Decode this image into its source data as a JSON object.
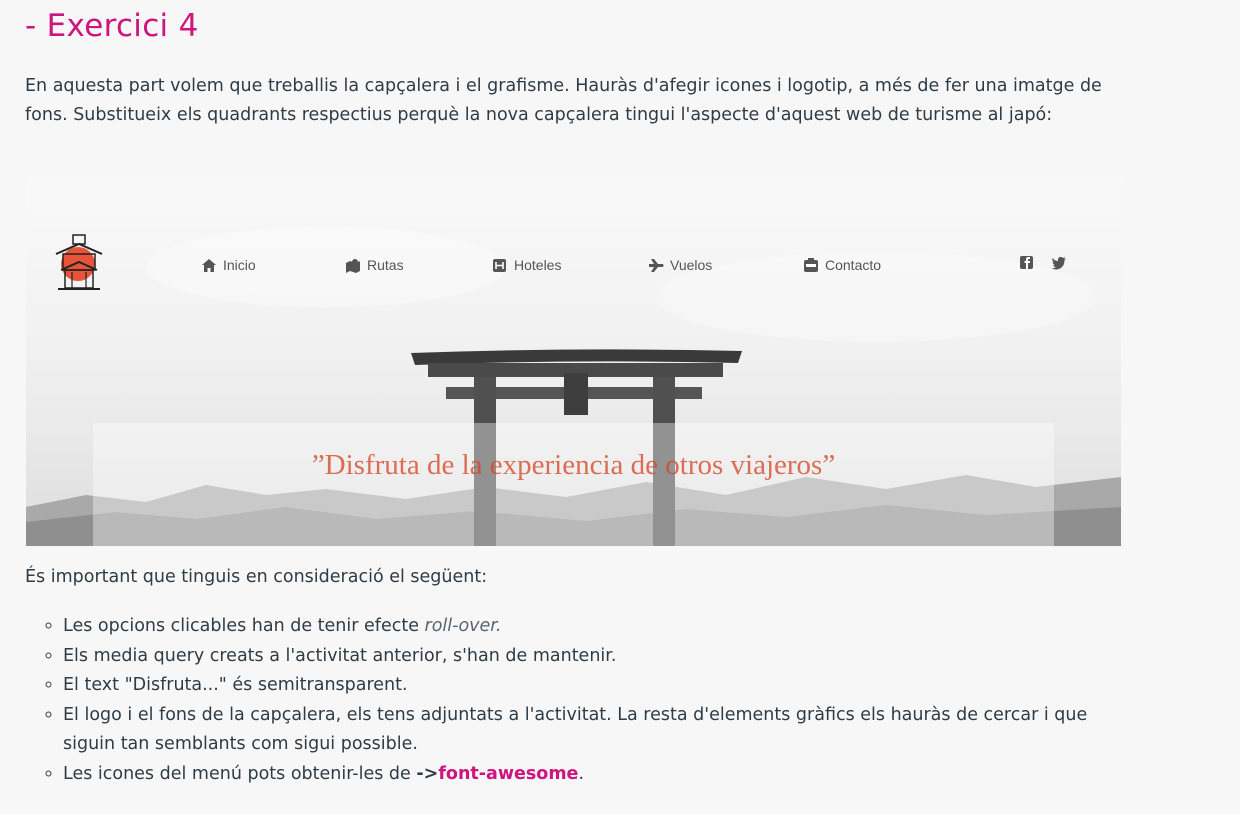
{
  "heading": "- Exercici 4",
  "intro": "En aquesta part volem que treballis la capçalera i el grafisme. Hauràs d'afegir icones i logotip, a més de fer una imatge de fons. Substitueix els quadrants respectius perquè la nova capçalera tingui l'aspecte d'aquest web de turisme al japó:",
  "preview": {
    "nav": [
      {
        "label": "Inicio",
        "icon": "home-icon"
      },
      {
        "label": "Rutas",
        "icon": "map-icon"
      },
      {
        "label": "Hoteles",
        "icon": "hotel-icon"
      },
      {
        "label": "Vuelos",
        "icon": "plane-icon"
      },
      {
        "label": "Contacto",
        "icon": "contact-icon"
      }
    ],
    "social": [
      "facebook-icon",
      "twitter-icon"
    ],
    "slogan": "”Disfruta de la experiencia de otros viajeros”"
  },
  "subheading": "És important que tinguis en consideració el següent:",
  "notes": {
    "item1_text": "Les opcions clicables han de tenir efecte ",
    "item1_em": "roll-over.",
    "item2": "Els media query creats a l'activitat anterior, s'han de mantenir.",
    "item3": "El text \"Disfruta...\" és semitransparent.",
    "item4": "El logo i el fons de la capçalera, els tens adjuntats a l'activitat. La resta d'elements gràfics els hauràs de cercar i que siguin tan semblants com sigui possible.",
    "item5_text": "Les icones del menú pots obtenir-les de ",
    "item5_arrow": "->",
    "item5_link": "font-awesome",
    "item5_end": "."
  },
  "colors": {
    "accent": "#cf137f",
    "text": "#2f3b45",
    "background": "#f7f7f7",
    "slogan": "#d64628"
  }
}
